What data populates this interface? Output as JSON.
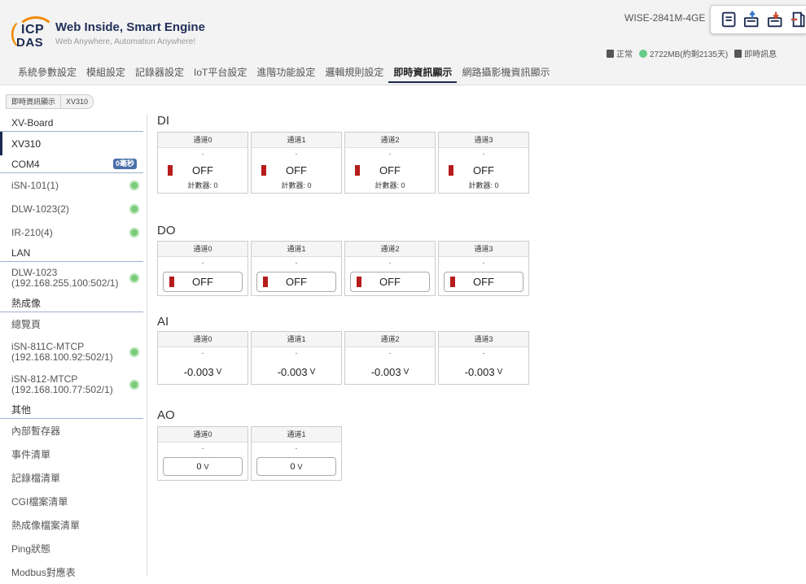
{
  "brand": {
    "logo_top": "ICP",
    "logo_bottom": "DAS",
    "title": "Web Inside, Smart Engine",
    "subtitle": "Web Anywhere, Automation Anywhere!"
  },
  "header": {
    "model": "WISE-2841M-4GE",
    "status": "正常",
    "storage": "2722MB(約剩2135天)",
    "realtime_info": "即時訊息"
  },
  "nav": [
    {
      "label": "系統參數設定"
    },
    {
      "label": "模組設定"
    },
    {
      "label": "記錄器設定"
    },
    {
      "label": "IoT平台設定"
    },
    {
      "label": "進階功能設定"
    },
    {
      "label": "邏輯規則設定"
    },
    {
      "label": "即時資訊顯示",
      "active": true
    },
    {
      "label": "網路攝影機資訊顯示"
    }
  ],
  "breadcrumb": [
    "即時資訊顯示",
    "XV310"
  ],
  "sidebar": {
    "xv_board": "XV-Board",
    "xv310": "XV310",
    "com4": "COM4",
    "com4_badge": "0毫秒",
    "isn101": "iSN-101(1)",
    "dlw1023_2": "DLW-1023(2)",
    "ir210": "IR-210(4)",
    "lan": "LAN",
    "dlw1023_lan_name": "DLW-1023",
    "dlw1023_lan_addr": "(192.168.255.100:502/1)",
    "thermal": "熱成像",
    "overview": "總覽頁",
    "isn811_name": "iSN-811C-MTCP",
    "isn811_addr": "(192.168.100.92:502/1)",
    "isn812_name": "iSN-812-MTCP",
    "isn812_addr": "(192.168.100.77:502/1)",
    "other": "其他",
    "internal_register": "內部暫存器",
    "event_list": "事件清單",
    "log_list": "記錄檔清單",
    "cgi_list": "CGI檔案清單",
    "thermal_list": "熱成像檔案清單",
    "ping_status": "Ping狀態",
    "modbus_table": "Modbus對應表"
  },
  "sections": {
    "di": {
      "title": "DI",
      "channels": [
        {
          "name": "通道0",
          "dash": "-",
          "state": "OFF",
          "counter": "計數器: 0"
        },
        {
          "name": "通道1",
          "dash": "-",
          "state": "OFF",
          "counter": "計數器: 0"
        },
        {
          "name": "通道2",
          "dash": "-",
          "state": "OFF",
          "counter": "計數器: 0"
        },
        {
          "name": "通道3",
          "dash": "-",
          "state": "OFF",
          "counter": "計數器: 0"
        }
      ]
    },
    "do": {
      "title": "DO",
      "channels": [
        {
          "name": "通道0",
          "dash": "-",
          "state": "OFF"
        },
        {
          "name": "通道1",
          "dash": "-",
          "state": "OFF"
        },
        {
          "name": "通道2",
          "dash": "-",
          "state": "OFF"
        },
        {
          "name": "通道3",
          "dash": "-",
          "state": "OFF"
        }
      ]
    },
    "ai": {
      "title": "AI",
      "unit": "V",
      "channels": [
        {
          "name": "通道0",
          "dash": "-",
          "value": "-0.003"
        },
        {
          "name": "通道1",
          "dash": "-",
          "value": "-0.003"
        },
        {
          "name": "通道2",
          "dash": "-",
          "value": "-0.003"
        },
        {
          "name": "通道3",
          "dash": "-",
          "value": "-0.003"
        }
      ]
    },
    "ao": {
      "title": "AO",
      "unit": "V",
      "channels": [
        {
          "name": "通道0",
          "dash": "-",
          "value": "0"
        },
        {
          "name": "通道1",
          "dash": "-",
          "value": "0"
        }
      ]
    }
  },
  "colors": {
    "off_indicator": "#b71c1c",
    "online_dot": "#7acb7a",
    "accent": "#1a2a50"
  }
}
